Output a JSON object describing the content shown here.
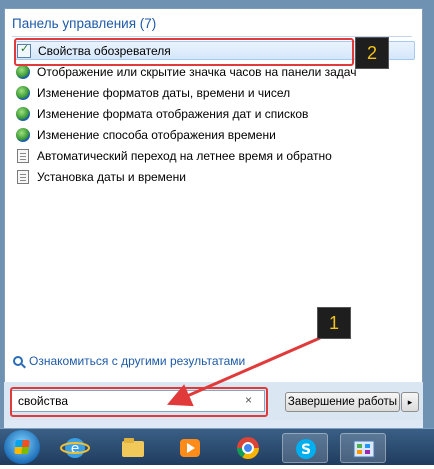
{
  "menu": {
    "section_title": "Панель управления (7)",
    "items": [
      {
        "label": "Свойства обозревателя",
        "icon": "internet-options-icon"
      },
      {
        "label": "Отображение или скрытие значка часов на панели задач",
        "icon": "globe-icon"
      },
      {
        "label": "Изменение форматов даты, времени и чисел",
        "icon": "globe-icon"
      },
      {
        "label": "Изменение формата отображения дат и списков",
        "icon": "globe-icon"
      },
      {
        "label": "Изменение способа отображения времени",
        "icon": "globe-icon"
      },
      {
        "label": "Автоматический переход на летнее время и обратно",
        "icon": "document-icon"
      },
      {
        "label": "Установка даты и времени",
        "icon": "document-icon"
      }
    ],
    "more_results": "Ознакомиться с другими результатами"
  },
  "search": {
    "value": "свойства",
    "clear": "×"
  },
  "shutdown": {
    "label": "Завершение работы",
    "arrow": "▸"
  },
  "annotations": {
    "badge_1": "1",
    "badge_2": "2",
    "highlight_color": "#e03a3a"
  },
  "taskbar": {
    "items": [
      "start-orb",
      "ie-icon",
      "explorer-icon",
      "media-player-icon",
      "chrome-icon",
      "skype-icon",
      "control-panel-icon"
    ]
  }
}
